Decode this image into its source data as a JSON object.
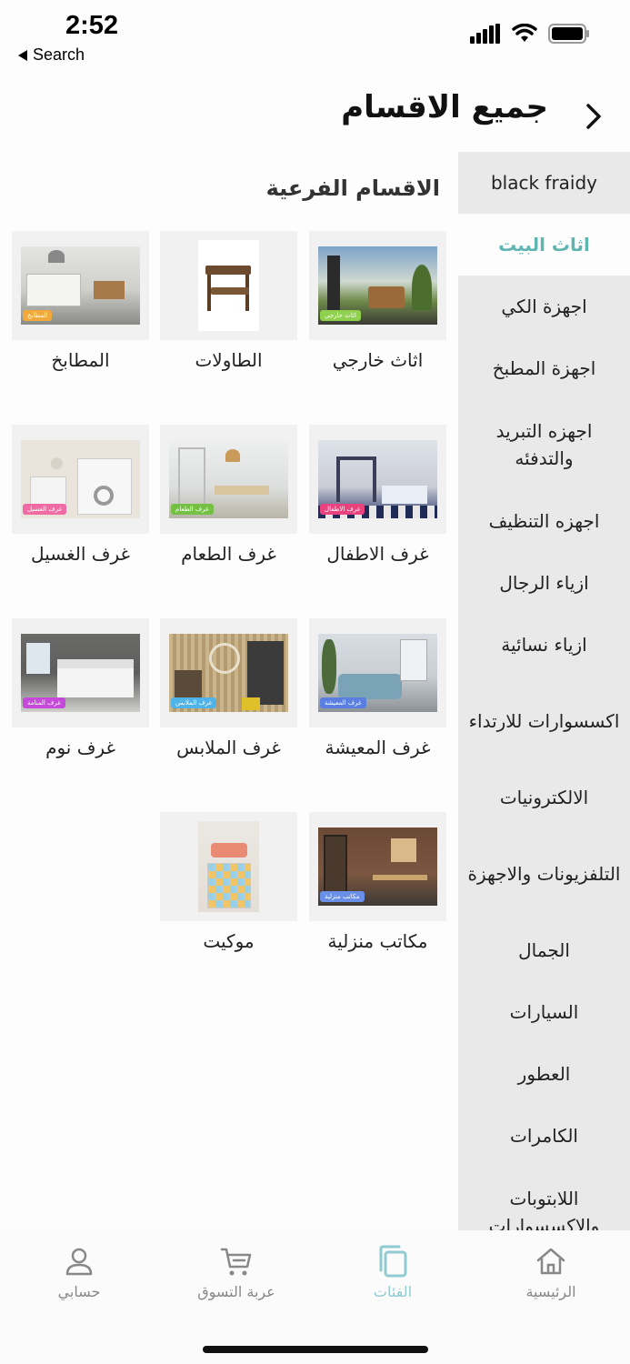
{
  "status_bar": {
    "time": "2:52",
    "back_label": "Search"
  },
  "header": {
    "title": "جميع الاقسام"
  },
  "sidebar": {
    "items": [
      {
        "label": "black fraidy"
      },
      {
        "label": "اثاث البيت",
        "active": true
      },
      {
        "label": "اجهزة الكي"
      },
      {
        "label": "اجهزة المطبخ"
      },
      {
        "label": "اجهزه التبريد والتدفئه"
      },
      {
        "label": "اجهزه التنظيف"
      },
      {
        "label": "ازياء الرجال"
      },
      {
        "label": "ازياء نسائية"
      },
      {
        "label": "اكسسوارات للارتداء"
      },
      {
        "label": "الالكترونيات"
      },
      {
        "label": "التلفزيونات والاجهزة"
      },
      {
        "label": "الجمال"
      },
      {
        "label": "السيارات"
      },
      {
        "label": "العطور"
      },
      {
        "label": "الكامرات"
      },
      {
        "label": "اللابتوبات والاكسسوارات"
      }
    ]
  },
  "subcategories": {
    "title": "الاقسام الفرعية",
    "items": [
      {
        "label": "اثاث خارجي",
        "tag": "اثاث خارجي",
        "tag_color": "#8fd14f"
      },
      {
        "label": "الطاولات",
        "tag": "",
        "tag_color": ""
      },
      {
        "label": "المطابخ",
        "tag": "المطابخ",
        "tag_color": "#f2a93b"
      },
      {
        "label": "غرف الاطفال",
        "tag": "غرف الاطفال",
        "tag_color": "#e9427f"
      },
      {
        "label": "غرف الطعام",
        "tag": "غرف الطعام",
        "tag_color": "#74c043"
      },
      {
        "label": "غرف الغسيل",
        "tag": "غرف الغسيل",
        "tag_color": "#f06aa4"
      },
      {
        "label": "غرف المعيشة",
        "tag": "غرف المعيشة",
        "tag_color": "#5b7fe0"
      },
      {
        "label": "غرف الملابس",
        "tag": "غرف الملابس",
        "tag_color": "#4fb3e8"
      },
      {
        "label": "غرف نوم",
        "tag": "غرف المنامة",
        "tag_color": "#c64ad9"
      },
      {
        "label": "مكاتب منزلية",
        "tag": "مكاتب منزلية",
        "tag_color": "#6a8fe8"
      },
      {
        "label": "موكيت",
        "tag": "",
        "tag_color": ""
      }
    ]
  },
  "bottom_nav": {
    "items": [
      {
        "label": "الرئيسية",
        "icon": "home-icon"
      },
      {
        "label": "الفئات",
        "icon": "categories-icon",
        "active": true
      },
      {
        "label": "عربة التسوق",
        "icon": "cart-icon"
      },
      {
        "label": "حسابي",
        "icon": "profile-icon"
      }
    ]
  },
  "colors": {
    "accent": "#5fb5b0",
    "sidebar_bg": "#e9e9e9",
    "card_bg": "#f1f1f1"
  }
}
